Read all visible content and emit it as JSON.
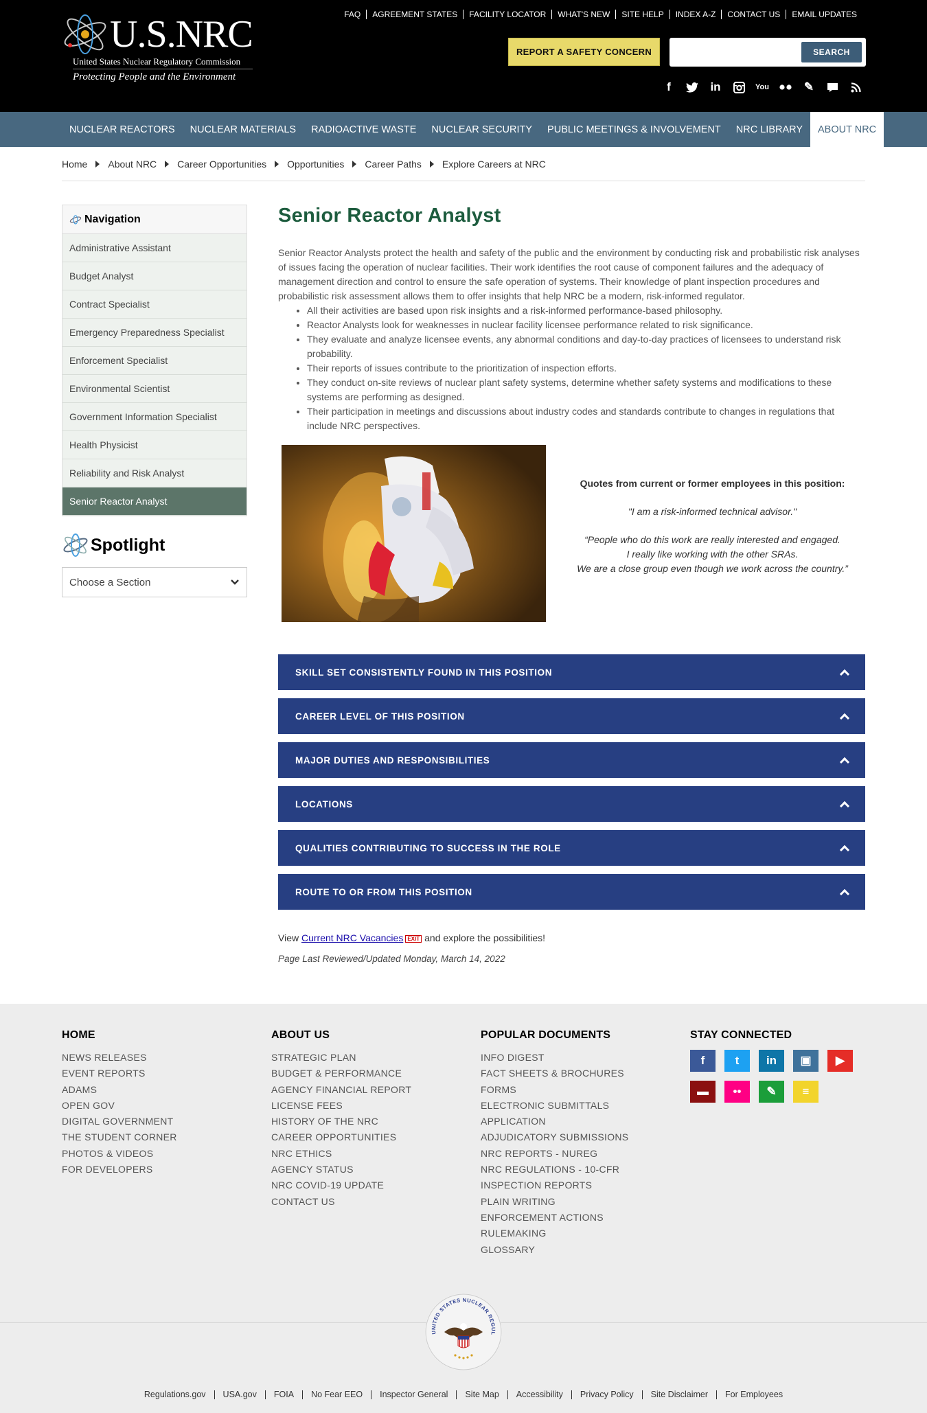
{
  "header": {
    "logo_main": "U.S.NRC",
    "logo_sub": "United States Nuclear Regulatory Commission",
    "logo_tagline": "Protecting People and the Environment",
    "util_links": [
      "FAQ",
      "AGREEMENT STATES",
      "FACILITY LOCATOR",
      "WHAT'S NEW",
      "SITE HELP",
      "INDEX A-Z",
      "CONTACT US",
      "EMAIL UPDATES"
    ],
    "report_button": "REPORT A SAFETY CONCERN",
    "search_placeholder": "",
    "search_button": "SEARCH",
    "social_icons": [
      "facebook-icon",
      "twitter-icon",
      "linkedin-icon",
      "instagram-icon",
      "youtube-icon",
      "flickr-icon",
      "pencil-icon",
      "comment-icon",
      "rss-icon"
    ]
  },
  "nav": {
    "items": [
      "NUCLEAR REACTORS",
      "NUCLEAR MATERIALS",
      "RADIOACTIVE WASTE",
      "NUCLEAR SECURITY",
      "PUBLIC MEETINGS & INVOLVEMENT",
      "NRC LIBRARY",
      "ABOUT NRC"
    ],
    "active": "ABOUT NRC"
  },
  "breadcrumb": [
    "Home",
    "About NRC",
    "Career Opportunities",
    "Opportunities",
    "Career Paths",
    "Explore Careers at NRC"
  ],
  "sidebar": {
    "title": "Navigation",
    "items": [
      "Administrative Assistant",
      "Budget Analyst",
      "Contract Specialist",
      "Emergency Preparedness Specialist",
      "Enforcement Specialist",
      "Environmental Scientist",
      "Government Information Specialist",
      "Health Physicist",
      "Reliability and Risk Analyst",
      "Senior Reactor Analyst"
    ],
    "active_index": 9,
    "spotlight_title": "Spotlight",
    "section_select": "Choose a Section"
  },
  "main": {
    "title": "Senior Reactor Analyst",
    "intro": "Senior Reactor Analysts protect the health and safety of the public and the environment by conducting risk and probabilistic risk analyses of issues facing the operation of nuclear facilities. Their work identifies the root cause of component failures and the adequacy of management direction and control to ensure the safe operation of systems. Their knowledge of plant inspection procedures and probabilistic risk assessment allows them to offer insights that help NRC be a modern, risk-informed regulator.",
    "bullets": [
      "All their activities are based upon risk insights and a risk-informed performance-based philosophy.",
      "Reactor Analysts look for weaknesses in nuclear facility licensee performance related to risk significance.",
      "They evaluate and analyze licensee events, any abnormal conditions and day-to-day practices of licensees to understand risk probability.",
      "Their reports of issues contribute to the prioritization of inspection efforts.",
      "They conduct on-site reviews of nuclear plant safety systems, determine whether safety systems and modifications to these systems are performing as designed.",
      "Their participation in meetings and discussions about industry codes and standards contribute to changes in regulations that include NRC perspectives."
    ],
    "quotes_heading": "Quotes from current or former employees in this position:",
    "quote1": "\"I am a risk-informed technical advisor.\"",
    "quote2_line1": "“People who do this work are really interested and engaged.",
    "quote2_line2": "I really like working with the other SRAs.",
    "quote2_line3": "We are a close group even though we work across the country.”",
    "accordion": [
      "SKILL SET CONSISTENTLY FOUND IN THIS POSITION",
      "CAREER LEVEL OF THIS POSITION",
      "MAJOR DUTIES AND RESPONSIBILITIES",
      "LOCATIONS",
      "QUALITIES CONTRIBUTING TO SUCCESS IN THE ROLE",
      "ROUTE TO OR FROM THIS POSITION"
    ],
    "vacancy_prefix": "View",
    "vacancy_link": "Current NRC Vacancies",
    "exit_badge": "EXIT",
    "vacancy_suffix": "and explore the possibilities!",
    "updated": "Page Last Reviewed/Updated Monday, March 14, 2022"
  },
  "footer": {
    "home": {
      "title": "HOME",
      "links": [
        "NEWS RELEASES",
        "EVENT REPORTS",
        "ADAMS",
        "OPEN GOV",
        "DIGITAL GOVERNMENT",
        "THE STUDENT CORNER",
        "PHOTOS & VIDEOS",
        "FOR DEVELOPERS"
      ]
    },
    "about": {
      "title": "ABOUT US",
      "links": [
        "STRATEGIC PLAN",
        "BUDGET & PERFORMANCE",
        "AGENCY FINANCIAL REPORT",
        "LICENSE FEES",
        "HISTORY OF THE NRC",
        "CAREER OPPORTUNITIES",
        "NRC ETHICS",
        "AGENCY STATUS",
        "NRC COVID-19 UPDATE",
        "CONTACT US"
      ]
    },
    "popular": {
      "title": "POPULAR DOCUMENTS",
      "links": [
        "INFO DIGEST",
        "FACT SHEETS & BROCHURES",
        "FORMS",
        "ELECTRONIC SUBMITTALS",
        "APPLICATION",
        "ADJUDICATORY SUBMISSIONS",
        "NRC REPORTS - NUREG",
        "NRC REGULATIONS - 10-CFR",
        "INSPECTION REPORTS",
        "PLAIN WRITING",
        "ENFORCEMENT ACTIONS",
        "RULEMAKING",
        "GLOSSARY"
      ]
    },
    "connected": {
      "title": "STAY CONNECTED",
      "icons": [
        {
          "name": "facebook-icon",
          "glyph": "f",
          "color": "#3b5998"
        },
        {
          "name": "twitter-icon",
          "glyph": "t",
          "color": "#1da1f2"
        },
        {
          "name": "linkedin-icon",
          "glyph": "in",
          "color": "#0e76a8"
        },
        {
          "name": "instagram-icon",
          "glyph": "▣",
          "color": "#3f729b"
        },
        {
          "name": "youtube-icon",
          "glyph": "▶",
          "color": "#e52d27"
        },
        {
          "name": "comment-icon",
          "glyph": "▬",
          "color": "#8b1010"
        },
        {
          "name": "flickr-icon",
          "glyph": "••",
          "color": "#ff0084"
        },
        {
          "name": "pencil-icon",
          "glyph": "✎",
          "color": "#1b9e3a"
        },
        {
          "name": "rss-icon",
          "glyph": "≡",
          "color": "#f2d42c"
        }
      ]
    },
    "seal_text": "UNITED STATES NUCLEAR REGULATORY COMMISSION",
    "bottom_links": [
      "Regulations.gov",
      "USA.gov",
      "FOIA",
      "No Fear EEO",
      "Inspector General",
      "Site Map",
      "Accessibility",
      "Privacy Policy",
      "Site Disclaimer",
      "For Employees"
    ]
  }
}
